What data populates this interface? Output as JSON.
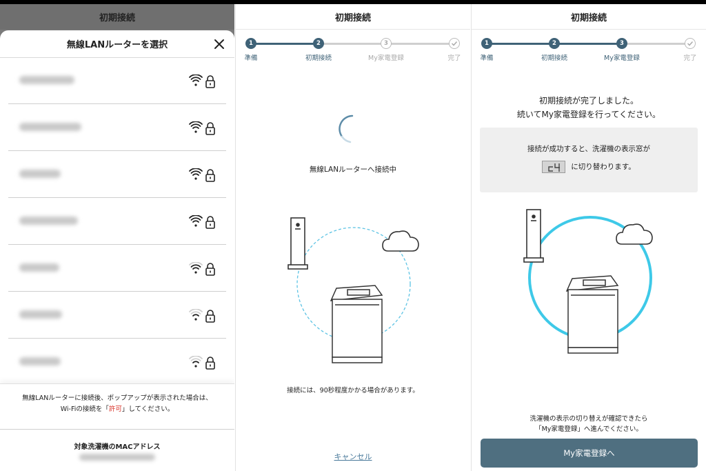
{
  "panel1": {
    "header_title": "初期接続",
    "sheet_title": "無線LANルーターを選択",
    "networks": [
      {
        "name": "",
        "signal": 3,
        "locked": true
      },
      {
        "name": "",
        "signal": 3,
        "locked": true
      },
      {
        "name": "",
        "signal": 3,
        "locked": true
      },
      {
        "name": "",
        "signal": 3,
        "locked": true
      },
      {
        "name": "",
        "signal": 2,
        "locked": true
      },
      {
        "name": "",
        "signal": 1,
        "locked": true
      },
      {
        "name": "",
        "signal": 1,
        "locked": true
      }
    ],
    "note_line1": "無線LANルーターに接続後、ポップアップが表示された場合は、",
    "note_line2_pre": "Wi-Fiの接続を「",
    "note_line2_highlight": "許可",
    "note_line2_post": "」してください。",
    "mac_label": "対象洗濯機のMACアドレス",
    "accent_red": "#d9352c"
  },
  "stepper": {
    "steps": [
      "準備",
      "初期接続",
      "My家電登録",
      "完了"
    ],
    "numbers": [
      "1",
      "2",
      "3"
    ],
    "accent": "#3f6277"
  },
  "panel2": {
    "header_title": "初期接続",
    "status": "無線LANルーターへ接続中",
    "note": "接続には、90秒程度かかる場合があります。",
    "cancel": "キャンセル",
    "current_step": 2
  },
  "panel3": {
    "header_title": "初期接続",
    "message_line1": "初期接続が完了しました。",
    "message_line2": "続いてMy家電登録を行ってください。",
    "info_line1": "接続が成功すると、洗濯機の表示窓が",
    "lcd_code": "c4",
    "info_line2": "に切り替わります。",
    "footer_line1": "洗濯機の表示の切り替えが確認できたら",
    "footer_line2": "「My家電登録」へ進んでください。",
    "next_button": "My家電登録へ",
    "current_step": 3,
    "circle_color": "#3ec9e8"
  }
}
